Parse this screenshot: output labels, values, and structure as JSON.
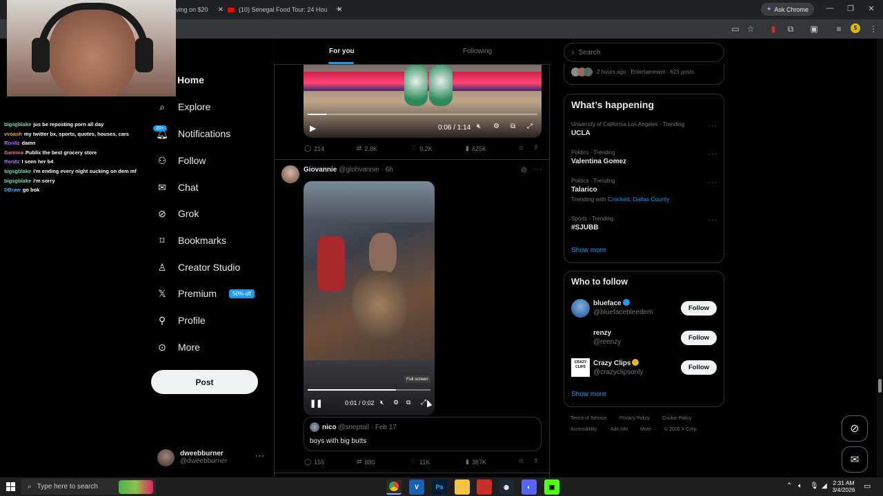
{
  "browser": {
    "tabs": [
      {
        "title": "ving on $20",
        "close": "✕"
      },
      {
        "title": "(10) Senegal Food Tour: 24 Hou",
        "close": "✕"
      }
    ],
    "new_tab": "+",
    "ask_chrome": "Ask Chrome"
  },
  "stream_chat": [
    {
      "user": "bigsgblake",
      "color": "#67e1a8",
      "msg": "jus be reposting porn all day"
    },
    {
      "user": "vvoash",
      "color": "#f2a53b",
      "msg": "my twitter bx, sports, quotes, houses, cars"
    },
    {
      "user": "Ron8z",
      "color": "#b36bff",
      "msg": "damn"
    },
    {
      "user": "Gannna",
      "color": "#ff6f9c",
      "msg": "Publix the best grocery store"
    },
    {
      "user": "Ron8z",
      "color": "#b36bff",
      "msg": "I seen her b4"
    },
    {
      "user": "bigsgblake",
      "color": "#67e1a8",
      "msg": "i'm ending every night sucking on dem mf"
    },
    {
      "user": "bigsgblake",
      "color": "#67e1a8",
      "msg": "i'm sorry"
    },
    {
      "user": "DBraw",
      "color": "#4ea6ff",
      "msg": "go bok"
    }
  ],
  "nav": {
    "home": "Home",
    "explore": "Explore",
    "notifications": "Notifications",
    "notif_badge": "20+",
    "follow": "Follow",
    "chat": "Chat",
    "grok": "Grok",
    "bookmarks": "Bookmarks",
    "creator_studio": "Creator Studio",
    "premium": "Premium",
    "premium_badge": "50% off",
    "profile": "Profile",
    "more": "More",
    "post": "Post"
  },
  "account": {
    "name": "dweebburner",
    "handle": "@dweebburner",
    "more": "···"
  },
  "timeline": {
    "tab_for_you": "For you",
    "tab_following": "Following",
    "post1": {
      "time": "0:06 / 1:14",
      "progress": 0.08,
      "replies": "214",
      "reposts": "2.8K",
      "likes": "9.2K",
      "views": "625K"
    },
    "post2": {
      "author": "Giovannie",
      "handle": "@glohvannie",
      "dot": "·",
      "age": "6h",
      "time": "0:01 / 0:02",
      "progress": 0.72,
      "tooltip": "Full screen",
      "quote": {
        "author": "nico",
        "handle": "@sneptail",
        "dot": "·",
        "date": "Feb 17",
        "text": "boys with big butts"
      },
      "replies": "155",
      "reposts": "880",
      "likes": "11K",
      "views": "387K"
    }
  },
  "sidebar": {
    "search_placeholder": "Search",
    "top_meta": "2 hours ago · Entertainment · 623 posts",
    "whats_happening": "What’s happening",
    "trends": [
      {
        "meta": "University of California Los Angeles · Trending",
        "name": "UCLA",
        "extra_prefix": "",
        "extra_link": ""
      },
      {
        "meta": "Politics · Trending",
        "name": "Valentina Gomez",
        "extra_prefix": "",
        "extra_link": ""
      },
      {
        "meta": "Politics · Trending",
        "name": "Talarico",
        "extra_prefix": "Trending with",
        "extra_link": "Crockett, Dallas County"
      },
      {
        "meta": "Sports · Trending",
        "name": "#SJUBB",
        "extra_prefix": "",
        "extra_link": ""
      }
    ],
    "show_more": "Show more",
    "who_to_follow": "Who to follow",
    "follow_suggestions": [
      {
        "name": "blueface",
        "handle": "@bluefacebleedem",
        "verified": "#1d9bf0",
        "btn": "Follow"
      },
      {
        "name": "renzy",
        "handle": "@reenzy",
        "verified": "",
        "btn": "Follow"
      },
      {
        "name": "Crazy Clips",
        "handle": "@crazyclipsonly",
        "verified": "#e2b719",
        "btn": "Follow"
      }
    ],
    "show_more_2": "Show more",
    "footer": [
      "Terms of Service",
      "Privacy Policy",
      "Cookie Policy",
      "Accessibility",
      "Ads info",
      "More ···",
      "© 2026 X Corp."
    ],
    "crazy_clips_logo": "CRAZY CLIPS"
  },
  "taskbar": {
    "search": "Type here to search",
    "time": "2:31 AM",
    "date": "3/4/2026"
  },
  "colors": {
    "accent": "#1d9bf0",
    "bg": "#000000",
    "border": "#2f3336",
    "muted": "#71767b"
  }
}
